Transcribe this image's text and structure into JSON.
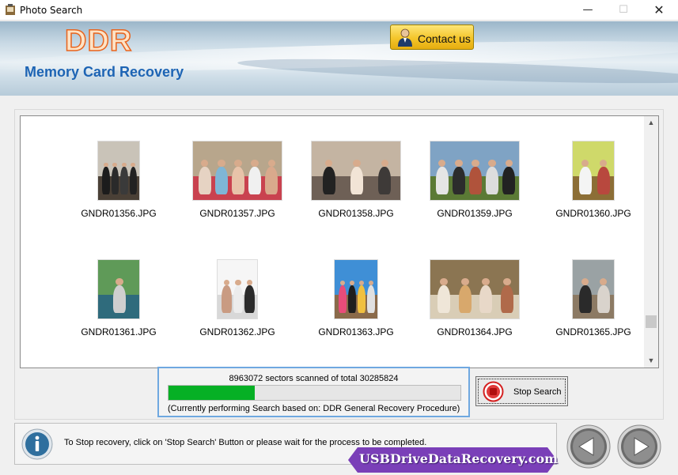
{
  "window": {
    "title": "Photo Search",
    "controls": {
      "minimize": "—",
      "maximize": "☐",
      "close": "✕"
    }
  },
  "header": {
    "brand": "DDR",
    "subtitle": "Memory Card Recovery",
    "contact_label": "Contact us"
  },
  "photos": [
    {
      "name": "GNDR01356.JPG",
      "thumb": "narrow",
      "sky": "#c9c3b8",
      "ground": "#4a4036",
      "figs": [
        "#1c1c1c",
        "#2a2a2a",
        "#3a3a3a",
        "#222"
      ]
    },
    {
      "name": "GNDR01357.JPG",
      "thumb": "wide",
      "sky": "#b8a68c",
      "ground": "#c9424f",
      "figs": [
        "#e6d3c3",
        "#7fb6d6",
        "#e8c3a9",
        "#f0f0f0",
        "#d9a98c"
      ]
    },
    {
      "name": "GNDR01358.JPG",
      "thumb": "wide",
      "sky": "#c4b4a2",
      "ground": "#6e6056",
      "figs": [
        "#222",
        "#f2e4d6",
        "#3e3a38"
      ]
    },
    {
      "name": "GNDR01359.JPG",
      "thumb": "wide",
      "sky": "#7fa3c4",
      "ground": "#5b7a35",
      "figs": [
        "#e5e5e5",
        "#2c2c2c",
        "#b0533b",
        "#ddd",
        "#222"
      ]
    },
    {
      "name": "GNDR01360.JPG",
      "thumb": "narrow",
      "sky": "#cfd96a",
      "ground": "#8c6e36",
      "figs": [
        "#f4f4f4",
        "#b8483e"
      ]
    },
    {
      "name": "GNDR01361.JPG",
      "thumb": "narrow",
      "sky": "#5f9a58",
      "ground": "#2f6b7c",
      "figs": [
        "#cfcfcf"
      ]
    },
    {
      "name": "GNDR01362.JPG",
      "thumb": "narrow",
      "sky": "#f6f6f6",
      "ground": "#d8d8d8",
      "figs": [
        "#c99b82",
        "#ececec",
        "#2b2b2b"
      ]
    },
    {
      "name": "GNDR01363.JPG",
      "thumb": "narrow",
      "sky": "#3f8fd6",
      "ground": "#8a6a4a",
      "figs": [
        "#e84c7a",
        "#1e1e1e",
        "#f0c040",
        "#e0e0e0"
      ]
    },
    {
      "name": "GNDR01364.JPG",
      "thumb": "wide",
      "sky": "#8b7552",
      "ground": "#d9cdb6",
      "figs": [
        "#efe6d8",
        "#d8a86c",
        "#e8d8c8",
        "#b06a4a"
      ]
    },
    {
      "name": "GNDR01365.JPG",
      "thumb": "narrow",
      "sky": "#9aa2a4",
      "ground": "#8c7a64",
      "figs": [
        "#2a2a2a",
        "#d9d3cc"
      ]
    }
  ],
  "progress": {
    "status_text": "8963072 sectors scanned of total 30285824",
    "fraction": 0.296,
    "procedure_text": "(Currently performing Search based on:  DDR General Recovery Procedure)"
  },
  "stop_button_label": "Stop Search",
  "status_message": "To Stop recovery, click on 'Stop Search' Button or please wait for the process to be completed.",
  "watermark": "USBDriveDataRecovery.com",
  "scroll": {
    "up": "▲",
    "down": "▼"
  },
  "icons": [
    "app-icon",
    "contact-person-icon",
    "stop-icon",
    "info-icon",
    "back-arrow-icon",
    "next-arrow-icon"
  ]
}
